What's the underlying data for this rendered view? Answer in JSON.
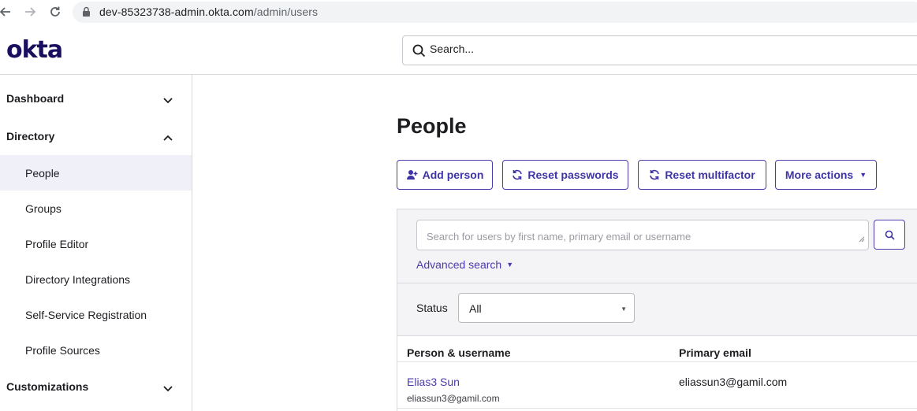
{
  "browser": {
    "url_host": "dev-85323738-admin.okta.com",
    "url_path": "/admin/users"
  },
  "header": {
    "logo": "okta",
    "search_placeholder": "Search..."
  },
  "sidebar": {
    "sections": [
      {
        "label": "Dashboard",
        "expanded": false
      },
      {
        "label": "Directory",
        "expanded": true
      },
      {
        "label": "Customizations",
        "expanded": false
      }
    ],
    "directory_items": [
      {
        "label": "People",
        "active": true
      },
      {
        "label": "Groups",
        "active": false
      },
      {
        "label": "Profile Editor",
        "active": false
      },
      {
        "label": "Directory Integrations",
        "active": false
      },
      {
        "label": "Self-Service Registration",
        "active": false
      },
      {
        "label": "Profile Sources",
        "active": false
      }
    ]
  },
  "main": {
    "title": "People",
    "actions": {
      "add_person": "Add person",
      "reset_passwords": "Reset passwords",
      "reset_multifactor": "Reset multifactor",
      "more_actions": "More actions"
    },
    "search": {
      "placeholder": "Search for users by first name, primary email or username",
      "advanced": "Advanced search"
    },
    "filter": {
      "status_label": "Status",
      "status_value": "All"
    },
    "table": {
      "columns": [
        "Person & username",
        "Primary email"
      ],
      "rows": [
        {
          "name": "Elias3 Sun",
          "username": "eliassun3@gamil.com",
          "email": "eliassun3@gamil.com"
        }
      ]
    }
  },
  "colors": {
    "brand": "#1a0f5e",
    "accent": "#4b3bab",
    "active_bg": "#f0f1f8"
  }
}
